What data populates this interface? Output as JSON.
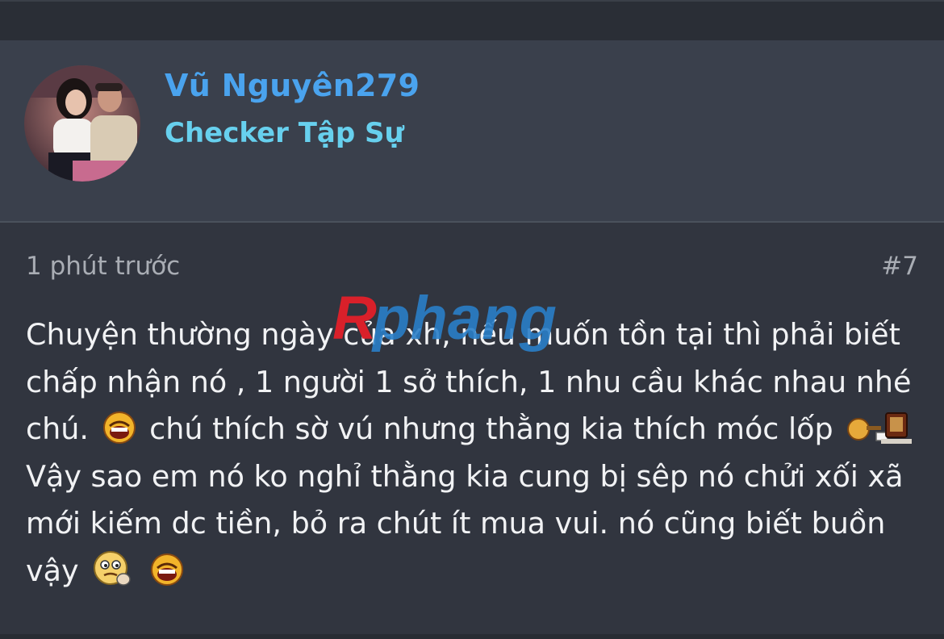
{
  "user": {
    "name": "Vũ Nguyên279",
    "title": "Checker Tập Sự"
  },
  "post": {
    "time": "1 phút trước",
    "number": "#7",
    "lines": [
      "Chuyện thường ngày của xh, nếu muốn tồn tại thì phải biết",
      "chấp nhận nó , 1 người 1 sở thích, 1 nhu cầu khác nhau nhé",
      "chú.",
      "chú thích sờ vú nhưng thằng kia thích móc lốp",
      "Vậy sao em nó ko nghỉ thằng kia cung bị sêp nó chửi xối xã",
      "mới kiếm dc tiền, bỏ ra chút ít mua vui. nó cũng biết buồn",
      "vậy"
    ]
  },
  "watermark": {
    "text": "Rphang"
  },
  "colors": {
    "username": "#4aa3ee",
    "user_title": "#67d0ee",
    "header_bg": "#3a404c",
    "post_bg": "#31353f",
    "text": "#f1f2f4",
    "muted": "#a9adb4"
  },
  "icons": [
    "avatar-photo",
    "laughing-smiley-icon",
    "pc-smiley-icon",
    "thinking-smiley-icon"
  ]
}
